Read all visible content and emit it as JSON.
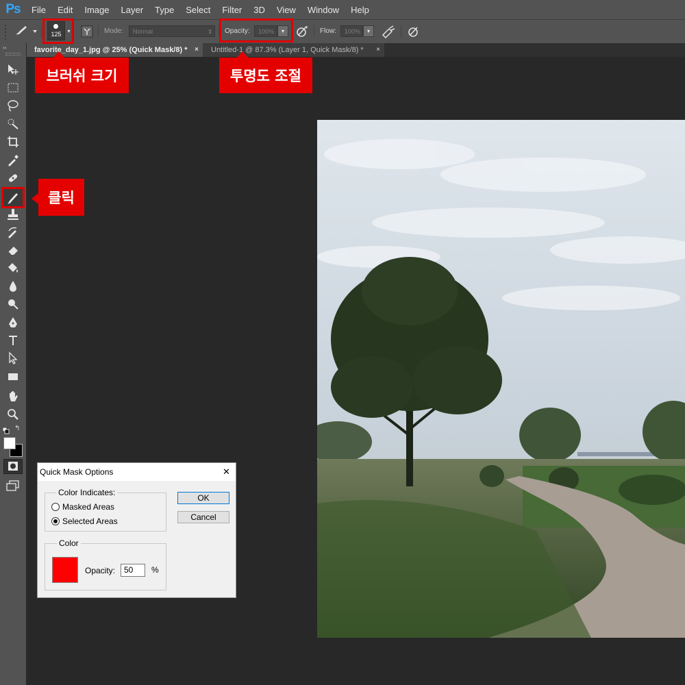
{
  "app": {
    "logo": "Ps"
  },
  "menu": [
    "File",
    "Edit",
    "Image",
    "Layer",
    "Type",
    "Select",
    "Filter",
    "3D",
    "View",
    "Window",
    "Help"
  ],
  "options_bar": {
    "brush_size": "125",
    "mode_label": "Mode:",
    "mode_value": "Normal",
    "opacity_label": "Opacity:",
    "opacity_value": "100%",
    "flow_label": "Flow:",
    "flow_value": "100%"
  },
  "tabs": [
    {
      "label": "favorite_day_1.jpg @ 25% (Quick Mask/8) *",
      "close": "×"
    },
    {
      "label": "Untitled-1 @ 87.3% (Layer 1, Quick Mask/8) *",
      "close": "×"
    }
  ],
  "annotations": {
    "brush_size": "브러쉬 크기",
    "opacity": "투명도 조절",
    "click": "클릭"
  },
  "tools": [
    "move-icon",
    "marquee-icon",
    "lasso-icon",
    "quick-select-icon",
    "crop-icon",
    "eyedropper-icon",
    "healing-icon",
    "brush-icon",
    "stamp-icon",
    "history-brush-icon",
    "eraser-icon",
    "paint-bucket-icon",
    "blur-icon",
    "dodge-icon",
    "pen-icon",
    "type-icon",
    "path-select-icon",
    "rectangle-icon",
    "hand-icon",
    "zoom-icon"
  ],
  "colors": {
    "foreground": "#ffffff",
    "background": "#000000",
    "mask_color": "#ff0000",
    "accent": "#e00000"
  },
  "dialog": {
    "title": "Quick Mask Options",
    "close": "✕",
    "color_indicates_label": "Color Indicates:",
    "masked_areas": "Masked Areas",
    "selected_areas": "Selected Areas",
    "color_label": "Color",
    "opacity_label": "Opacity:",
    "opacity_value": "50",
    "percent": "%",
    "ok": "OK",
    "cancel": "Cancel",
    "selected_option": "Selected Areas"
  }
}
